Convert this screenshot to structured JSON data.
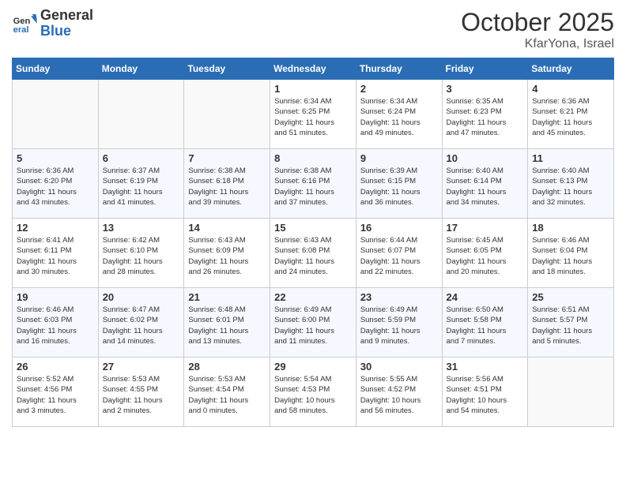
{
  "header": {
    "logo_general": "General",
    "logo_blue": "Blue",
    "month_title": "October 2025",
    "location": "KfarYona, Israel"
  },
  "days_of_week": [
    "Sunday",
    "Monday",
    "Tuesday",
    "Wednesday",
    "Thursday",
    "Friday",
    "Saturday"
  ],
  "weeks": [
    [
      {
        "day": "",
        "info": ""
      },
      {
        "day": "",
        "info": ""
      },
      {
        "day": "",
        "info": ""
      },
      {
        "day": "1",
        "info": "Sunrise: 6:34 AM\nSunset: 6:25 PM\nDaylight: 11 hours\nand 51 minutes."
      },
      {
        "day": "2",
        "info": "Sunrise: 6:34 AM\nSunset: 6:24 PM\nDaylight: 11 hours\nand 49 minutes."
      },
      {
        "day": "3",
        "info": "Sunrise: 6:35 AM\nSunset: 6:23 PM\nDaylight: 11 hours\nand 47 minutes."
      },
      {
        "day": "4",
        "info": "Sunrise: 6:36 AM\nSunset: 6:21 PM\nDaylight: 11 hours\nand 45 minutes."
      }
    ],
    [
      {
        "day": "5",
        "info": "Sunrise: 6:36 AM\nSunset: 6:20 PM\nDaylight: 11 hours\nand 43 minutes."
      },
      {
        "day": "6",
        "info": "Sunrise: 6:37 AM\nSunset: 6:19 PM\nDaylight: 11 hours\nand 41 minutes."
      },
      {
        "day": "7",
        "info": "Sunrise: 6:38 AM\nSunset: 6:18 PM\nDaylight: 11 hours\nand 39 minutes."
      },
      {
        "day": "8",
        "info": "Sunrise: 6:38 AM\nSunset: 6:16 PM\nDaylight: 11 hours\nand 37 minutes."
      },
      {
        "day": "9",
        "info": "Sunrise: 6:39 AM\nSunset: 6:15 PM\nDaylight: 11 hours\nand 36 minutes."
      },
      {
        "day": "10",
        "info": "Sunrise: 6:40 AM\nSunset: 6:14 PM\nDaylight: 11 hours\nand 34 minutes."
      },
      {
        "day": "11",
        "info": "Sunrise: 6:40 AM\nSunset: 6:13 PM\nDaylight: 11 hours\nand 32 minutes."
      }
    ],
    [
      {
        "day": "12",
        "info": "Sunrise: 6:41 AM\nSunset: 6:11 PM\nDaylight: 11 hours\nand 30 minutes."
      },
      {
        "day": "13",
        "info": "Sunrise: 6:42 AM\nSunset: 6:10 PM\nDaylight: 11 hours\nand 28 minutes."
      },
      {
        "day": "14",
        "info": "Sunrise: 6:43 AM\nSunset: 6:09 PM\nDaylight: 11 hours\nand 26 minutes."
      },
      {
        "day": "15",
        "info": "Sunrise: 6:43 AM\nSunset: 6:08 PM\nDaylight: 11 hours\nand 24 minutes."
      },
      {
        "day": "16",
        "info": "Sunrise: 6:44 AM\nSunset: 6:07 PM\nDaylight: 11 hours\nand 22 minutes."
      },
      {
        "day": "17",
        "info": "Sunrise: 6:45 AM\nSunset: 6:05 PM\nDaylight: 11 hours\nand 20 minutes."
      },
      {
        "day": "18",
        "info": "Sunrise: 6:46 AM\nSunset: 6:04 PM\nDaylight: 11 hours\nand 18 minutes."
      }
    ],
    [
      {
        "day": "19",
        "info": "Sunrise: 6:46 AM\nSunset: 6:03 PM\nDaylight: 11 hours\nand 16 minutes."
      },
      {
        "day": "20",
        "info": "Sunrise: 6:47 AM\nSunset: 6:02 PM\nDaylight: 11 hours\nand 14 minutes."
      },
      {
        "day": "21",
        "info": "Sunrise: 6:48 AM\nSunset: 6:01 PM\nDaylight: 11 hours\nand 13 minutes."
      },
      {
        "day": "22",
        "info": "Sunrise: 6:49 AM\nSunset: 6:00 PM\nDaylight: 11 hours\nand 11 minutes."
      },
      {
        "day": "23",
        "info": "Sunrise: 6:49 AM\nSunset: 5:59 PM\nDaylight: 11 hours\nand 9 minutes."
      },
      {
        "day": "24",
        "info": "Sunrise: 6:50 AM\nSunset: 5:58 PM\nDaylight: 11 hours\nand 7 minutes."
      },
      {
        "day": "25",
        "info": "Sunrise: 6:51 AM\nSunset: 5:57 PM\nDaylight: 11 hours\nand 5 minutes."
      }
    ],
    [
      {
        "day": "26",
        "info": "Sunrise: 5:52 AM\nSunset: 4:56 PM\nDaylight: 11 hours\nand 3 minutes."
      },
      {
        "day": "27",
        "info": "Sunrise: 5:53 AM\nSunset: 4:55 PM\nDaylight: 11 hours\nand 2 minutes."
      },
      {
        "day": "28",
        "info": "Sunrise: 5:53 AM\nSunset: 4:54 PM\nDaylight: 11 hours\nand 0 minutes."
      },
      {
        "day": "29",
        "info": "Sunrise: 5:54 AM\nSunset: 4:53 PM\nDaylight: 10 hours\nand 58 minutes."
      },
      {
        "day": "30",
        "info": "Sunrise: 5:55 AM\nSunset: 4:52 PM\nDaylight: 10 hours\nand 56 minutes."
      },
      {
        "day": "31",
        "info": "Sunrise: 5:56 AM\nSunset: 4:51 PM\nDaylight: 10 hours\nand 54 minutes."
      },
      {
        "day": "",
        "info": ""
      }
    ]
  ]
}
